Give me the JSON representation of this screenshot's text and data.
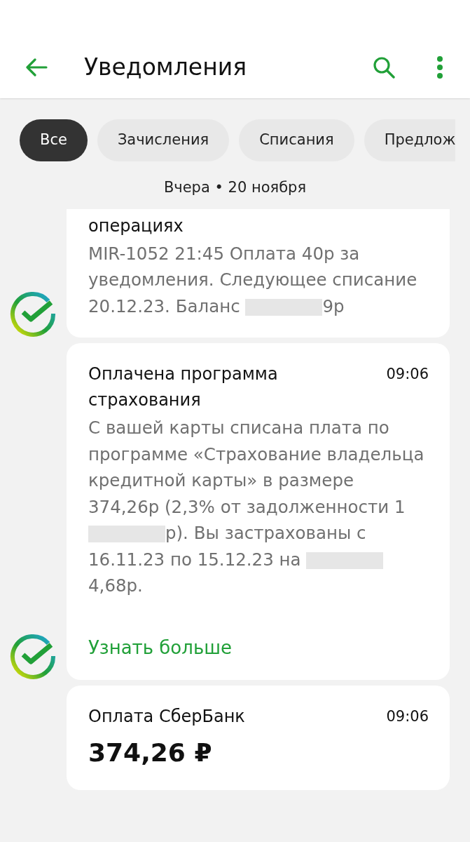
{
  "toolbar": {
    "title": "Уведомления"
  },
  "filters": [
    {
      "label": "Все",
      "selected": true
    },
    {
      "label": "Зачисления",
      "selected": false
    },
    {
      "label": "Списания",
      "selected": false
    },
    {
      "label": "Предлож",
      "selected": false
    }
  ],
  "date_header": "Вчера • 20 ноября",
  "notifications": [
    {
      "title": "операциях",
      "body": [
        {
          "kind": "text",
          "text": "MIR-1052 21:45 Оплата 40р за уведомления. Следующее списание 20.12.23. Баланс "
        },
        {
          "kind": "redacted"
        },
        {
          "kind": "text",
          "text": "9р"
        }
      ]
    },
    {
      "title": "Оплачена программа страхования",
      "time": "09:06",
      "body": [
        {
          "kind": "text",
          "text": "С вашей карты списана плата по программе «Страхование владельца кредитной карты» в размере 374,26р (2,3% от задолженности 1"
        },
        {
          "kind": "redacted"
        },
        {
          "kind": "text",
          "text": "р). Вы застрахованы с 16.11.23 по 15.12.23 на "
        },
        {
          "kind": "redacted"
        },
        {
          "kind": "text",
          "text": "4,68р."
        }
      ],
      "link": "Узнать больше"
    },
    {
      "title": "Оплата СберБанк",
      "time": "09:06",
      "amount": "374,26 ₽"
    }
  ]
}
